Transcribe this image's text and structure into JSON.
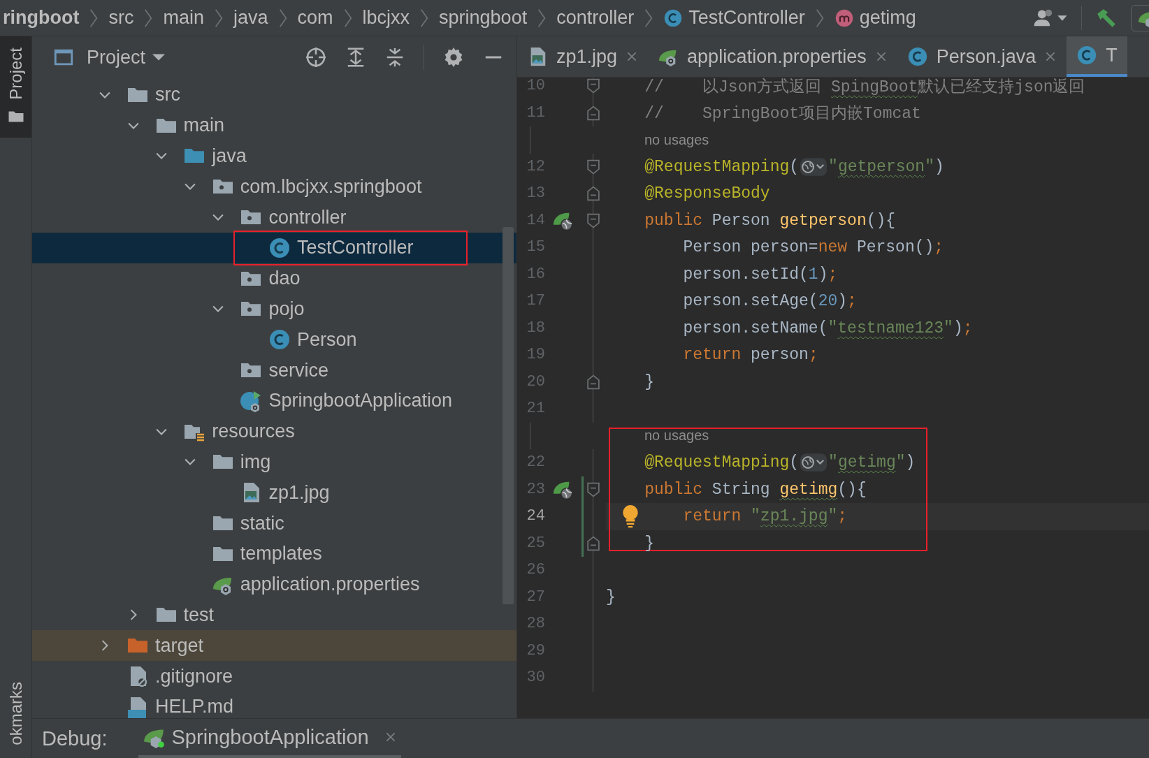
{
  "breadcrumbs": [
    {
      "label": "ringboot",
      "kind": "module"
    },
    {
      "label": "src",
      "kind": "folder"
    },
    {
      "label": "main",
      "kind": "folder"
    },
    {
      "label": "java",
      "kind": "folder"
    },
    {
      "label": "com",
      "kind": "folder"
    },
    {
      "label": "lbcjxx",
      "kind": "folder"
    },
    {
      "label": "springboot",
      "kind": "folder"
    },
    {
      "label": "controller",
      "kind": "folder"
    },
    {
      "label": "TestController",
      "kind": "class"
    },
    {
      "label": "getimg",
      "kind": "method"
    }
  ],
  "tool_stripe": {
    "top": [
      {
        "label": "Project",
        "selected": true
      }
    ],
    "bottom": [
      {
        "label": "okmarks",
        "selected": false
      }
    ]
  },
  "project_panel": {
    "title": "Project",
    "tree": [
      {
        "label": "src",
        "kind": "folder",
        "selected": false,
        "expanded": true,
        "children": [
          {
            "label": "main",
            "kind": "folder",
            "selected": false,
            "expanded": true,
            "children": [
              {
                "label": "java",
                "kind": "source-folder",
                "selected": false,
                "expanded": true,
                "children": [
                  {
                    "label": "com.lbcjxx.springboot",
                    "kind": "package",
                    "selected": false,
                    "expanded": true,
                    "children": [
                      {
                        "label": "controller",
                        "kind": "package",
                        "selected": false,
                        "expanded": true,
                        "children": [
                          {
                            "label": "TestController",
                            "kind": "class",
                            "selected": true,
                            "framed": true
                          }
                        ]
                      },
                      {
                        "label": "dao",
                        "kind": "package",
                        "selected": false
                      },
                      {
                        "label": "pojo",
                        "kind": "package",
                        "selected": false,
                        "expanded": true,
                        "children": [
                          {
                            "label": "Person",
                            "kind": "class",
                            "selected": false
                          }
                        ]
                      },
                      {
                        "label": "service",
                        "kind": "package",
                        "selected": false
                      },
                      {
                        "label": "SpringbootApplication",
                        "kind": "spring-app",
                        "selected": false
                      }
                    ]
                  }
                ]
              },
              {
                "label": "resources",
                "kind": "resources-folder",
                "selected": false,
                "expanded": true,
                "children": [
                  {
                    "label": "img",
                    "kind": "folder",
                    "selected": false,
                    "expanded": true,
                    "children": [
                      {
                        "label": "zp1.jpg",
                        "kind": "image-file",
                        "selected": false
                      }
                    ]
                  },
                  {
                    "label": "static",
                    "kind": "folder",
                    "selected": false
                  },
                  {
                    "label": "templates",
                    "kind": "folder",
                    "selected": false
                  },
                  {
                    "label": "application.properties",
                    "kind": "properties-file",
                    "selected": false
                  }
                ]
              }
            ]
          },
          {
            "label": "test",
            "kind": "folder",
            "selected": false,
            "expanded": false
          }
        ]
      },
      {
        "label": "target",
        "kind": "excluded-folder",
        "selected": false,
        "expanded": false
      },
      {
        "label": ".gitignore",
        "kind": "ignore-file",
        "selected": false
      },
      {
        "label": "HELP.md",
        "kind": "md-file",
        "selected": false
      }
    ]
  },
  "editor_tabs": [
    {
      "label": "zp1.jpg",
      "kind": "image-file",
      "selected": false
    },
    {
      "label": "application.properties",
      "kind": "properties-file",
      "selected": false
    },
    {
      "label": "Person.java",
      "kind": "class",
      "selected": false
    },
    {
      "label": "T",
      "kind": "class",
      "selected": true
    }
  ],
  "code_lines": [
    {
      "kind": "code",
      "number": "10",
      "fold_start": true,
      "tokens": [
        {
          "text": "    //    以Json方式返回 ",
          "kind": "comment"
        },
        {
          "text": "SpingBoot",
          "kind": "comment",
          "typo": true
        },
        {
          "text": "默认已经支持json返回",
          "kind": "comment"
        }
      ]
    },
    {
      "kind": "code",
      "number": "11",
      "fold_end": true,
      "tokens": [
        {
          "text": "    //    SpringBoot项目内嵌Tomcat",
          "kind": "comment"
        }
      ]
    },
    {
      "kind": "hint",
      "text": "no usages"
    },
    {
      "kind": "code",
      "number": "12",
      "fold_start": true,
      "tokens": [
        {
          "text": "    @RequestMapping",
          "kind": "annotation"
        },
        {
          "text": "(",
          "kind": "plain"
        },
        {
          "kind": "inlay"
        },
        {
          "text": "\"",
          "kind": "string"
        },
        {
          "text": "getperson",
          "kind": "string",
          "typo": true
        },
        {
          "text": "\"",
          "kind": "string"
        },
        {
          "text": ")",
          "kind": "plain"
        }
      ]
    },
    {
      "kind": "code",
      "number": "13",
      "fold_end": true,
      "tokens": [
        {
          "text": "    @ResponseBody",
          "kind": "annotation"
        }
      ]
    },
    {
      "kind": "code",
      "number": "14",
      "fold_start": true,
      "endpoint": true,
      "tokens": [
        {
          "text": "    public",
          "kind": "keyword"
        },
        {
          "text": " Person ",
          "kind": "plain"
        },
        {
          "text": "getperson",
          "kind": "method"
        },
        {
          "text": "(){",
          "kind": "plain"
        }
      ]
    },
    {
      "kind": "code",
      "number": "15",
      "tokens": [
        {
          "text": "        Person person=",
          "kind": "plain"
        },
        {
          "text": "new",
          "kind": "keyword"
        },
        {
          "text": " Person()",
          "kind": "plain"
        },
        {
          "text": ";",
          "kind": "keyword"
        }
      ]
    },
    {
      "kind": "code",
      "number": "16",
      "tokens": [
        {
          "text": "        person.setId(",
          "kind": "plain"
        },
        {
          "text": "1",
          "kind": "number"
        },
        {
          "text": ")",
          "kind": "plain"
        },
        {
          "text": ";",
          "kind": "keyword"
        }
      ]
    },
    {
      "kind": "code",
      "number": "17",
      "tokens": [
        {
          "text": "        person.setAge(",
          "kind": "plain"
        },
        {
          "text": "20",
          "kind": "number"
        },
        {
          "text": ")",
          "kind": "plain"
        },
        {
          "text": ";",
          "kind": "keyword"
        }
      ]
    },
    {
      "kind": "code",
      "number": "18",
      "tokens": [
        {
          "text": "        person.setName(",
          "kind": "plain"
        },
        {
          "text": "\"",
          "kind": "string"
        },
        {
          "text": "testname123",
          "kind": "string",
          "typo": true
        },
        {
          "text": "\"",
          "kind": "string"
        },
        {
          "text": ")",
          "kind": "plain"
        },
        {
          "text": ";",
          "kind": "keyword"
        }
      ]
    },
    {
      "kind": "code",
      "number": "19",
      "tokens": [
        {
          "text": "        return",
          "kind": "keyword"
        },
        {
          "text": " person",
          "kind": "plain"
        },
        {
          "text": ";",
          "kind": "keyword"
        }
      ]
    },
    {
      "kind": "code",
      "number": "20",
      "fold_end": true,
      "tokens": [
        {
          "text": "    }",
          "kind": "plain"
        }
      ]
    },
    {
      "kind": "code",
      "number": "21"
    },
    {
      "kind": "hint",
      "text": "no usages",
      "boxed": true
    },
    {
      "kind": "code",
      "number": "22",
      "boxed": true,
      "tokens": [
        {
          "text": "    @RequestMapping",
          "kind": "annotation"
        },
        {
          "text": "(",
          "kind": "plain"
        },
        {
          "kind": "inlay"
        },
        {
          "text": "\"",
          "kind": "string"
        },
        {
          "text": "getimg",
          "kind": "string",
          "typo": true
        },
        {
          "text": "\"",
          "kind": "string"
        },
        {
          "text": ")",
          "kind": "plain"
        }
      ]
    },
    {
      "kind": "code",
      "number": "23",
      "boxed": true,
      "fold_start": true,
      "endpoint": true,
      "changed": true,
      "tokens": [
        {
          "text": "    public",
          "kind": "keyword"
        },
        {
          "text": " String ",
          "kind": "plain"
        },
        {
          "text": "getimg",
          "kind": "method",
          "typo": true
        },
        {
          "text": "(){",
          "kind": "plain"
        }
      ]
    },
    {
      "kind": "code",
      "number": "24",
      "boxed": true,
      "current": true,
      "bulb": true,
      "changed": true,
      "tokens": [
        {
          "text": "        return ",
          "kind": "keyword"
        },
        {
          "text": "\"",
          "kind": "string"
        },
        {
          "text": "zp1.jpg",
          "kind": "string",
          "typo": true
        },
        {
          "text": "\"",
          "kind": "string"
        },
        {
          "text": ";",
          "kind": "keyword"
        }
      ]
    },
    {
      "kind": "code",
      "number": "25",
      "boxed": true,
      "fold_end": true,
      "changed": true,
      "tokens": [
        {
          "text": "    }",
          "kind": "plain"
        }
      ]
    },
    {
      "kind": "code",
      "number": "26"
    },
    {
      "kind": "code",
      "number": "27",
      "tokens": [
        {
          "text": "}",
          "kind": "plain"
        }
      ]
    },
    {
      "kind": "code",
      "number": "28"
    },
    {
      "kind": "code",
      "number": "29"
    },
    {
      "kind": "code",
      "number": "30"
    }
  ],
  "debug_bar": {
    "label": "Debug:",
    "tabs": [
      {
        "label": "SpringbootApplication",
        "kind": "spring-app",
        "selected": true
      }
    ]
  }
}
